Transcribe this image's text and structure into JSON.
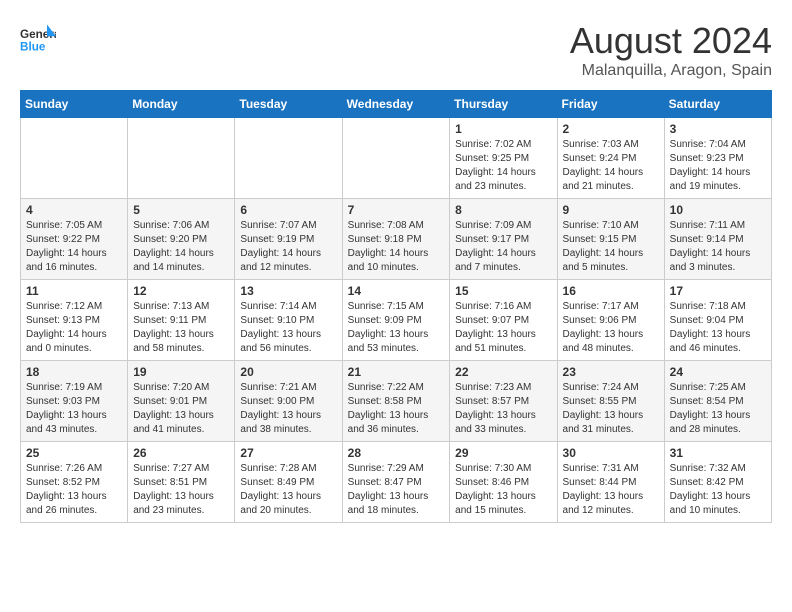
{
  "logo": {
    "line1": "General",
    "line2": "Blue"
  },
  "title": "August 2024",
  "location": "Malanquilla, Aragon, Spain",
  "weekdays": [
    "Sunday",
    "Monday",
    "Tuesday",
    "Wednesday",
    "Thursday",
    "Friday",
    "Saturday"
  ],
  "weeks": [
    [
      null,
      null,
      null,
      null,
      {
        "day": 1,
        "sunrise": "7:02 AM",
        "sunset": "9:25 PM",
        "daylight": "14 hours and 23 minutes."
      },
      {
        "day": 2,
        "sunrise": "7:03 AM",
        "sunset": "9:24 PM",
        "daylight": "14 hours and 21 minutes."
      },
      {
        "day": 3,
        "sunrise": "7:04 AM",
        "sunset": "9:23 PM",
        "daylight": "14 hours and 19 minutes."
      }
    ],
    [
      {
        "day": 4,
        "sunrise": "7:05 AM",
        "sunset": "9:22 PM",
        "daylight": "14 hours and 16 minutes."
      },
      {
        "day": 5,
        "sunrise": "7:06 AM",
        "sunset": "9:20 PM",
        "daylight": "14 hours and 14 minutes."
      },
      {
        "day": 6,
        "sunrise": "7:07 AM",
        "sunset": "9:19 PM",
        "daylight": "14 hours and 12 minutes."
      },
      {
        "day": 7,
        "sunrise": "7:08 AM",
        "sunset": "9:18 PM",
        "daylight": "14 hours and 10 minutes."
      },
      {
        "day": 8,
        "sunrise": "7:09 AM",
        "sunset": "9:17 PM",
        "daylight": "14 hours and 7 minutes."
      },
      {
        "day": 9,
        "sunrise": "7:10 AM",
        "sunset": "9:15 PM",
        "daylight": "14 hours and 5 minutes."
      },
      {
        "day": 10,
        "sunrise": "7:11 AM",
        "sunset": "9:14 PM",
        "daylight": "14 hours and 3 minutes."
      }
    ],
    [
      {
        "day": 11,
        "sunrise": "7:12 AM",
        "sunset": "9:13 PM",
        "daylight": "14 hours and 0 minutes."
      },
      {
        "day": 12,
        "sunrise": "7:13 AM",
        "sunset": "9:11 PM",
        "daylight": "13 hours and 58 minutes."
      },
      {
        "day": 13,
        "sunrise": "7:14 AM",
        "sunset": "9:10 PM",
        "daylight": "13 hours and 56 minutes."
      },
      {
        "day": 14,
        "sunrise": "7:15 AM",
        "sunset": "9:09 PM",
        "daylight": "13 hours and 53 minutes."
      },
      {
        "day": 15,
        "sunrise": "7:16 AM",
        "sunset": "9:07 PM",
        "daylight": "13 hours and 51 minutes."
      },
      {
        "day": 16,
        "sunrise": "7:17 AM",
        "sunset": "9:06 PM",
        "daylight": "13 hours and 48 minutes."
      },
      {
        "day": 17,
        "sunrise": "7:18 AM",
        "sunset": "9:04 PM",
        "daylight": "13 hours and 46 minutes."
      }
    ],
    [
      {
        "day": 18,
        "sunrise": "7:19 AM",
        "sunset": "9:03 PM",
        "daylight": "13 hours and 43 minutes."
      },
      {
        "day": 19,
        "sunrise": "7:20 AM",
        "sunset": "9:01 PM",
        "daylight": "13 hours and 41 minutes."
      },
      {
        "day": 20,
        "sunrise": "7:21 AM",
        "sunset": "9:00 PM",
        "daylight": "13 hours and 38 minutes."
      },
      {
        "day": 21,
        "sunrise": "7:22 AM",
        "sunset": "8:58 PM",
        "daylight": "13 hours and 36 minutes."
      },
      {
        "day": 22,
        "sunrise": "7:23 AM",
        "sunset": "8:57 PM",
        "daylight": "13 hours and 33 minutes."
      },
      {
        "day": 23,
        "sunrise": "7:24 AM",
        "sunset": "8:55 PM",
        "daylight": "13 hours and 31 minutes."
      },
      {
        "day": 24,
        "sunrise": "7:25 AM",
        "sunset": "8:54 PM",
        "daylight": "13 hours and 28 minutes."
      }
    ],
    [
      {
        "day": 25,
        "sunrise": "7:26 AM",
        "sunset": "8:52 PM",
        "daylight": "13 hours and 26 minutes."
      },
      {
        "day": 26,
        "sunrise": "7:27 AM",
        "sunset": "8:51 PM",
        "daylight": "13 hours and 23 minutes."
      },
      {
        "day": 27,
        "sunrise": "7:28 AM",
        "sunset": "8:49 PM",
        "daylight": "13 hours and 20 minutes."
      },
      {
        "day": 28,
        "sunrise": "7:29 AM",
        "sunset": "8:47 PM",
        "daylight": "13 hours and 18 minutes."
      },
      {
        "day": 29,
        "sunrise": "7:30 AM",
        "sunset": "8:46 PM",
        "daylight": "13 hours and 15 minutes."
      },
      {
        "day": 30,
        "sunrise": "7:31 AM",
        "sunset": "8:44 PM",
        "daylight": "13 hours and 12 minutes."
      },
      {
        "day": 31,
        "sunrise": "7:32 AM",
        "sunset": "8:42 PM",
        "daylight": "13 hours and 10 minutes."
      }
    ]
  ]
}
